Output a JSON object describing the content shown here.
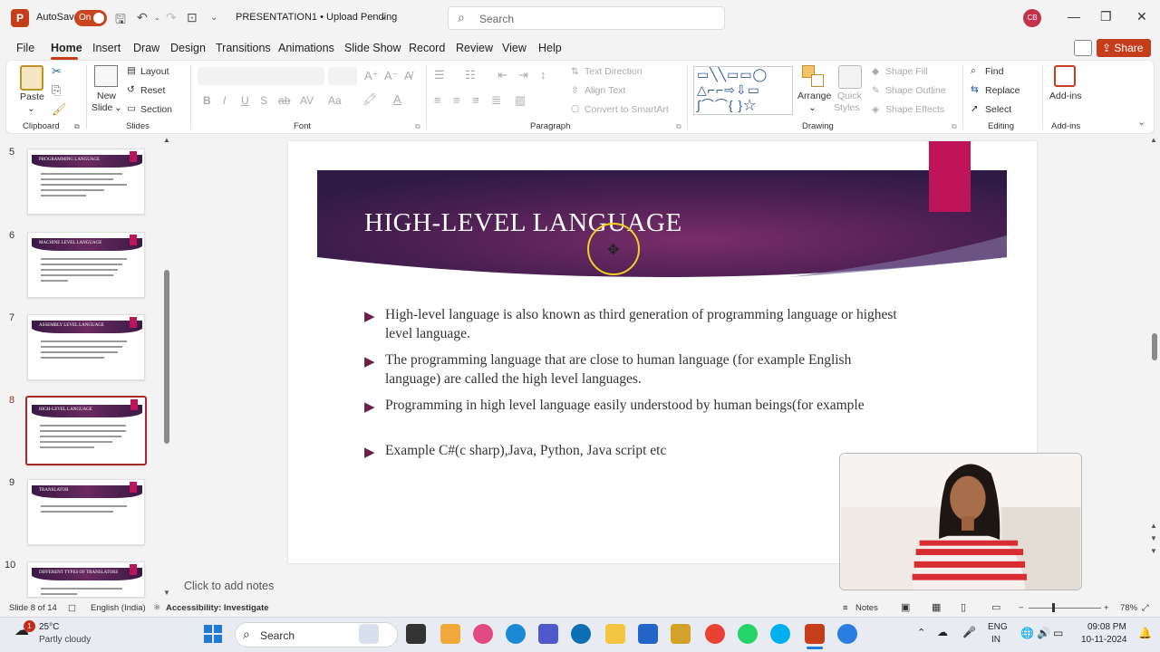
{
  "titlebar": {
    "autosave_label": "AutoSave",
    "autosave_state": "On",
    "document_title": "PRESENTATION1 • Upload Pending",
    "search_placeholder": "Search",
    "avatar_initials": "CB"
  },
  "menu": {
    "items": [
      "File",
      "Home",
      "Insert",
      "Draw",
      "Design",
      "Transitions",
      "Animations",
      "Slide Show",
      "Record",
      "Review",
      "View",
      "Help"
    ],
    "active": "Home",
    "share_label": "Share"
  },
  "ribbon": {
    "clipboard": {
      "paste": "Paste",
      "group": "Clipboard"
    },
    "slides": {
      "new_slide": "New",
      "new_slide2": "Slide",
      "layout": "Layout",
      "reset": "Reset",
      "section": "Section",
      "group": "Slides"
    },
    "font": {
      "group": "Font",
      "bold": "B",
      "italic": "I",
      "underline": "U",
      "shadow": "S",
      "strike": "ab",
      "spacing": "AV",
      "case": "Aa"
    },
    "paragraph": {
      "text_direction": "Text Direction",
      "align_text": "Align Text",
      "convert": "Convert to SmartArt",
      "group": "Paragraph"
    },
    "drawing": {
      "arrange": "Arrange",
      "quick_styles": "Quick",
      "quick_styles2": "Styles",
      "shape_fill": "Shape Fill",
      "shape_outline": "Shape Outline",
      "shape_effects": "Shape Effects",
      "group": "Drawing"
    },
    "editing": {
      "find": "Find",
      "replace": "Replace",
      "select": "Select",
      "group": "Editing"
    },
    "addins": {
      "label": "Add-ins",
      "group": "Add-ins"
    }
  },
  "thumbnails": [
    {
      "num": "5",
      "title": "PROGRAMMING LANGUAGE"
    },
    {
      "num": "6",
      "title": "MACHINE LEVEL LANGUAGE"
    },
    {
      "num": "7",
      "title": "ASSEMBLY LEVEL LANGUAGE"
    },
    {
      "num": "8",
      "title": "HIGH-LEVEL LANGUAGE"
    },
    {
      "num": "9",
      "title": "TRANSLATOR"
    },
    {
      "num": "10",
      "title": "DIFFERENT TYPES OF TRANSLATORS"
    }
  ],
  "slide": {
    "title": "HIGH-LEVEL LANGUAGE",
    "bullets": [
      "High-level language  is also known as third generation of programming language or highest level language.",
      "The programming language that are close to human language (for example English language) are called the high level languages.",
      "Programming in high level language easily understood by human beings(for example",
      "Example C#(c sharp),Java, Python, Java script etc"
    ],
    "notes_placeholder": "Click to add notes"
  },
  "statusbar": {
    "slide_info": "Slide 8 of 14",
    "language": "English (India)",
    "accessibility": "Accessibility: Investigate",
    "notes": "Notes",
    "zoom": "78%"
  },
  "taskbar": {
    "temperature": "25°C",
    "weather": "Partly cloudy",
    "weather_badge": "1",
    "search_label": "Search",
    "lang1": "ENG",
    "lang2": "IN",
    "time": "09:08 PM",
    "date": "10-11-2024"
  },
  "colors": {
    "accent": "#c43e1c",
    "slide_banner": "#4a1f52",
    "slide_accent": "#c0145a",
    "bullet": "#6a1f4a"
  }
}
